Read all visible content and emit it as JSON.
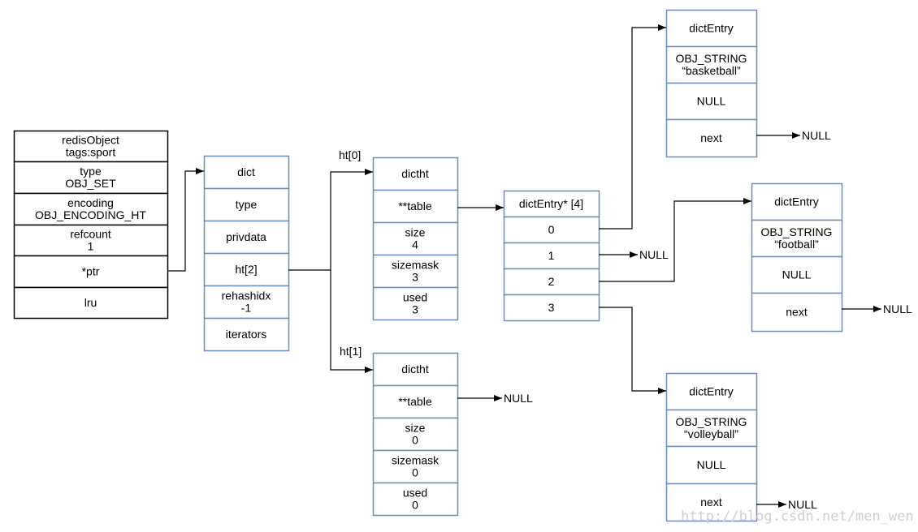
{
  "colors": {
    "black_box": "#000000",
    "blue_box": "#6c8ebf",
    "line": "#000000",
    "watermark": "#d0d0d0"
  },
  "structures": {
    "redisObject": {
      "style": "black",
      "rows": [
        [
          "redisObject",
          "tags:sport"
        ],
        [
          "type",
          "OBJ_SET"
        ],
        [
          "encoding",
          "OBJ_ENCODING_HT"
        ],
        [
          "refcount",
          "1"
        ],
        [
          "*ptr"
        ],
        [
          "lru"
        ]
      ]
    },
    "dict": {
      "style": "blue",
      "rows": [
        [
          "dict"
        ],
        [
          "type"
        ],
        [
          "privdata"
        ],
        [
          "ht[2]"
        ],
        [
          "rehashidx",
          "-1"
        ],
        [
          "iterators"
        ]
      ]
    },
    "dictht0": {
      "style": "blue",
      "label": "ht[0]",
      "rows": [
        [
          "dictht"
        ],
        [
          "**table"
        ],
        [
          "size",
          "4"
        ],
        [
          "sizemask",
          "3"
        ],
        [
          "used",
          "3"
        ]
      ]
    },
    "dictht1": {
      "style": "blue",
      "label": "ht[1]",
      "rows": [
        [
          "dictht"
        ],
        [
          "**table"
        ],
        [
          "size",
          "0"
        ],
        [
          "sizemask",
          "0"
        ],
        [
          "used",
          "0"
        ]
      ]
    },
    "table": {
      "style": "blue",
      "rows": [
        [
          "dictEntry* [4]"
        ],
        [
          "0"
        ],
        [
          "1"
        ],
        [
          "2"
        ],
        [
          "3"
        ]
      ]
    },
    "entry_basketball": {
      "style": "blue",
      "rows": [
        [
          "dictEntry"
        ],
        [
          "OBJ_STRING",
          "“basketball”"
        ],
        [
          "NULL"
        ],
        [
          "next"
        ]
      ]
    },
    "entry_football": {
      "style": "blue",
      "rows": [
        [
          "dictEntry"
        ],
        [
          "OBJ_STRING",
          "“football”"
        ],
        [
          "NULL"
        ],
        [
          "next"
        ]
      ]
    },
    "entry_volleyball": {
      "style": "blue",
      "rows": [
        [
          "dictEntry"
        ],
        [
          "OBJ_STRING",
          "“volleyball”"
        ],
        [
          "NULL"
        ],
        [
          "next"
        ]
      ]
    }
  },
  "null_label": "NULL",
  "watermark": "http://blog.csdn.net/men_wen"
}
